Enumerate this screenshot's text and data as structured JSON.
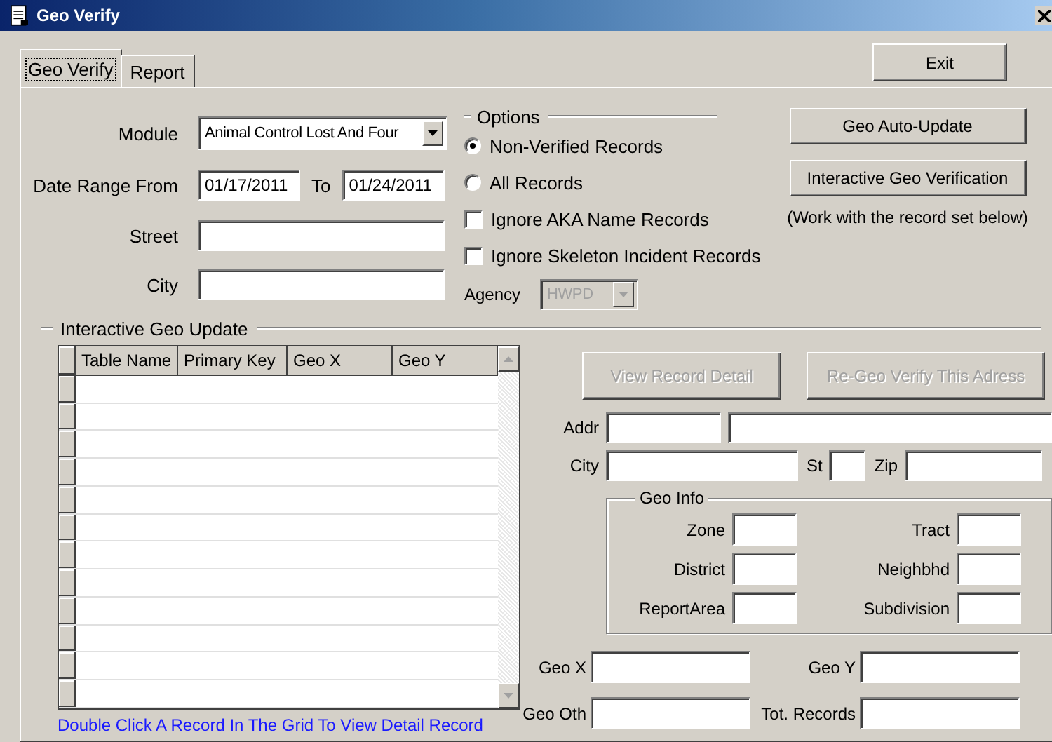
{
  "window": {
    "title": "Geo Verify"
  },
  "tabs": [
    {
      "label": "Geo Verify",
      "selected": true
    },
    {
      "label": "Report",
      "selected": false
    }
  ],
  "exit_button": {
    "label": "Exit"
  },
  "filters": {
    "module": {
      "label": "Module",
      "value": "Animal Control Lost And Four"
    },
    "date_range": {
      "label": "Date Range From",
      "from": "01/17/2011",
      "to_label": "To",
      "to": "01/24/2011"
    },
    "street": {
      "label": "Street"
    },
    "city": {
      "label": "City"
    }
  },
  "options": {
    "title": "Options",
    "items": [
      {
        "kind": "radio",
        "label": "Non-Verified Records",
        "checked": true
      },
      {
        "kind": "radio",
        "label": "All Records",
        "checked": false
      },
      {
        "kind": "checkbox",
        "label": "Ignore AKA Name Records",
        "checked": false
      },
      {
        "kind": "checkbox",
        "label": "Ignore Skeleton Incident Records",
        "checked": false
      }
    ],
    "agency": {
      "label": "Agency",
      "value": "HWPD",
      "disabled": true
    }
  },
  "actions": [
    {
      "label": "Geo Auto-Update",
      "disabled": false
    },
    {
      "label": "Interactive Geo Verification",
      "disabled": false
    }
  ],
  "actions_note": "(Work with the record set below)",
  "update": {
    "title": "Interactive Geo Update",
    "grid": {
      "columns": [
        "Table Name",
        "Primary Key",
        "Geo X",
        "Geo Y"
      ]
    },
    "hint": "Double Click A Record In The Grid To View Detail Record",
    "buttons": [
      {
        "label": "View Record Detail",
        "disabled": true
      },
      {
        "label": "Re-Geo Verify This Adress",
        "disabled": true
      }
    ],
    "address": {
      "addr_label": "Addr",
      "city_label": "City",
      "st_label": "St",
      "zip_label": "Zip"
    },
    "geo_info": {
      "title": "Geo Info",
      "fields": [
        "Zone",
        "Tract",
        "District",
        "Neighbhd",
        "ReportArea",
        "Subdivision"
      ]
    },
    "coords": [
      "Geo X",
      "Geo Y",
      "Geo Oth",
      "Tot. Records"
    ]
  }
}
